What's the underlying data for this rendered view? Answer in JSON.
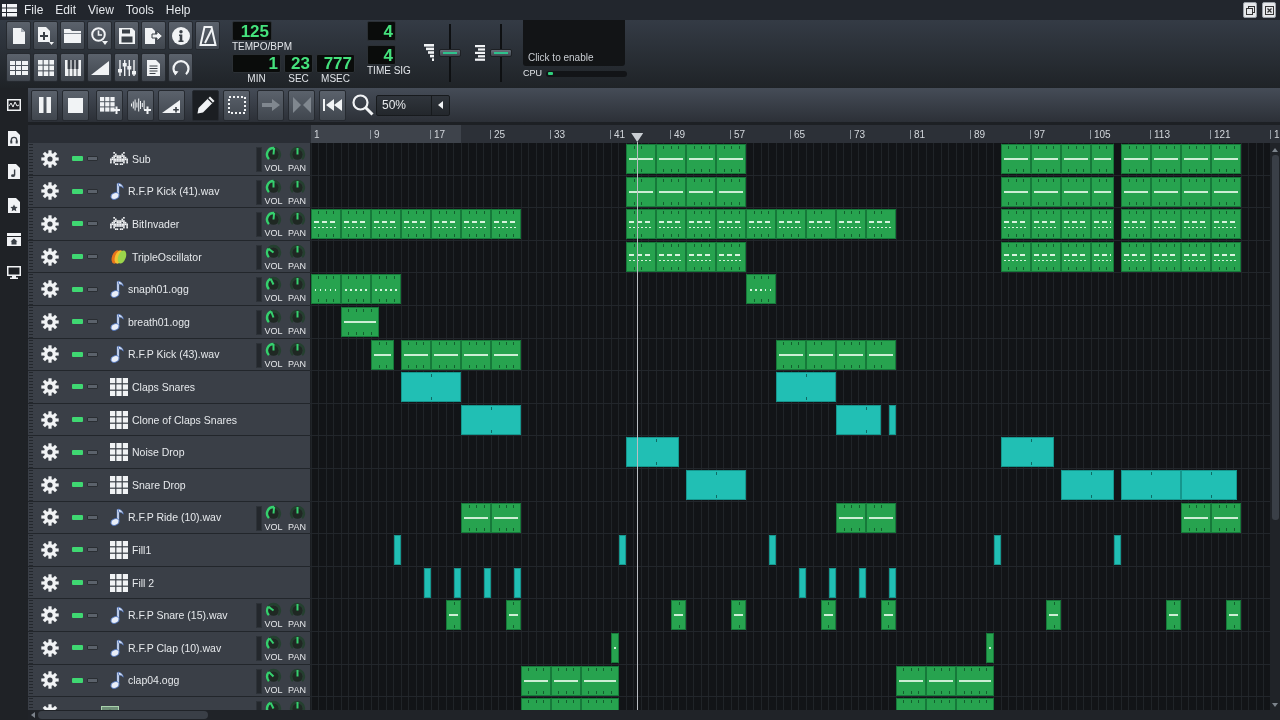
{
  "menu_bar": {
    "items": [
      "File",
      "Edit",
      "View",
      "Tools",
      "Help"
    ]
  },
  "toolbar": {
    "tempo": {
      "value": "125",
      "label": "TEMPO/BPM"
    },
    "clock": [
      {
        "value": "1",
        "label": "MIN"
      },
      {
        "value": "23",
        "label": "SEC"
      },
      {
        "value": "777",
        "label": "MSEC"
      }
    ],
    "time_signature": {
      "numerator": "4",
      "denominator": "4",
      "label": "TIME SIG"
    },
    "master_volume": {
      "level": 0.5
    },
    "master_pitch": {
      "level": 0.5
    },
    "cpu": {
      "message": "Click to enable",
      "label": "CPU",
      "level": 0.07
    }
  },
  "song_editor": {
    "toolbar": {
      "edit_modes": [
        {
          "selected": true
        },
        {
          "selected": false
        }
      ],
      "nav_buttons": [
        {
          "disabled": true
        },
        {
          "disabled": true
        },
        {
          "disabled": false
        }
      ],
      "zoom": "50%"
    },
    "ruler": {
      "ticks": [
        "1",
        "9",
        "17",
        "25",
        "33",
        "41",
        "49",
        "57",
        "65",
        "73",
        "81",
        "89",
        "97",
        "105",
        "113",
        "121",
        "1"
      ]
    },
    "tracks": [
      {
        "name": "Sub",
        "kind": "bitinvader",
        "muted": false,
        "solo": false,
        "knobs": [
          {
            "label": "VOL",
            "level": 0.52
          },
          {
            "label": "PAN",
            "level": 0.5
          }
        ]
      },
      {
        "name": "R.F.P Kick (41).wav",
        "kind": "sampler",
        "muted": false,
        "solo": false,
        "knobs": [
          {
            "label": "VOL",
            "level": 0.5
          },
          {
            "label": "PAN",
            "level": 0.5
          }
        ]
      },
      {
        "name": "BitInvader",
        "kind": "bitinvader",
        "muted": false,
        "solo": false,
        "knobs": [
          {
            "label": "VOL",
            "level": 0.52
          },
          {
            "label": "PAN",
            "level": 0.5
          }
        ]
      },
      {
        "name": "TripleOscillator",
        "kind": "oscillator",
        "muted": false,
        "solo": false,
        "knobs": [
          {
            "label": "VOL",
            "level": 0.3
          },
          {
            "label": "PAN",
            "level": 0.5
          }
        ]
      },
      {
        "name": "snaph01.ogg",
        "kind": "sampler",
        "muted": false,
        "solo": false,
        "knobs": [
          {
            "label": "VOL",
            "level": 0.4
          },
          {
            "label": "PAN",
            "level": 0.5
          }
        ]
      },
      {
        "name": "breath01.ogg",
        "kind": "sampler",
        "muted": false,
        "solo": false,
        "knobs": [
          {
            "label": "VOL",
            "level": 0.42
          },
          {
            "label": "PAN",
            "level": 0.5
          }
        ]
      },
      {
        "name": "R.F.P Kick (43).wav",
        "kind": "sampler",
        "muted": false,
        "solo": false,
        "knobs": [
          {
            "label": "VOL",
            "level": 0.5
          },
          {
            "label": "PAN",
            "level": 0.5
          }
        ]
      },
      {
        "name": "Claps Snares",
        "kind": "beat",
        "muted": false,
        "solo": false
      },
      {
        "name": "Clone of Claps Snares",
        "kind": "beat",
        "muted": false,
        "solo": false
      },
      {
        "name": "Noise Drop",
        "kind": "beat",
        "muted": false,
        "solo": false
      },
      {
        "name": "Snare Drop",
        "kind": "beat",
        "muted": false,
        "solo": false
      },
      {
        "name": "R.F.P Ride (10).wav",
        "kind": "sampler",
        "muted": false,
        "solo": false,
        "knobs": [
          {
            "label": "VOL",
            "level": 0.52
          },
          {
            "label": "PAN",
            "level": 0.5
          }
        ]
      },
      {
        "name": "Fill1",
        "kind": "beat",
        "muted": false,
        "solo": false
      },
      {
        "name": "Fill 2",
        "kind": "beat",
        "muted": false,
        "solo": false
      },
      {
        "name": "R.F.P Snare (15).wav",
        "kind": "sampler",
        "muted": false,
        "solo": false,
        "knobs": [
          {
            "label": "VOL",
            "level": 0.3
          },
          {
            "label": "PAN",
            "level": 0.5
          }
        ]
      },
      {
        "name": "R.F.P Clap (10).wav",
        "kind": "sampler",
        "muted": false,
        "solo": false,
        "knobs": [
          {
            "label": "VOL",
            "level": 0.36
          },
          {
            "label": "PAN",
            "level": 0.5
          }
        ]
      },
      {
        "name": "clap04.ogg",
        "kind": "sampler",
        "muted": false,
        "solo": false,
        "knobs": [
          {
            "label": "VOL",
            "level": 0.33
          },
          {
            "label": "PAN",
            "level": 0.5
          }
        ]
      },
      {
        "kind": "plugin",
        "knobs": [
          {
            "level": 0.4
          },
          {
            "level": 0.5
          }
        ]
      }
    ]
  }
}
